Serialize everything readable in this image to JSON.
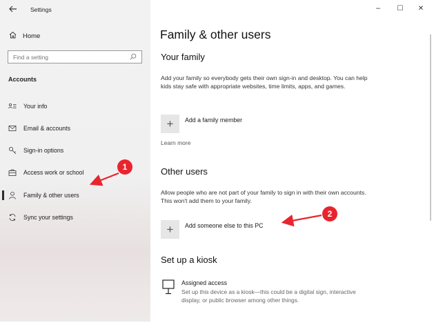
{
  "window": {
    "title": "Settings",
    "controls": {
      "minimize": "–",
      "maximize": "☐",
      "close": "✕"
    }
  },
  "sidebar": {
    "home_label": "Home",
    "search_placeholder": "Find a setting",
    "section_label": "Accounts",
    "items": [
      {
        "label": "Your info",
        "icon": "your-info-icon"
      },
      {
        "label": "Email & accounts",
        "icon": "mail-icon"
      },
      {
        "label": "Sign-in options",
        "icon": "key-icon"
      },
      {
        "label": "Access work or school",
        "icon": "briefcase-icon"
      },
      {
        "label": "Family & other users",
        "icon": "person-icon",
        "selected": true
      },
      {
        "label": "Sync your settings",
        "icon": "sync-icon"
      }
    ]
  },
  "main": {
    "title": "Family & other users",
    "your_family": {
      "heading": "Your family",
      "description": "Add your family so everybody gets their own sign-in and desktop. You can help kids stay safe with appropriate websites, time limits, apps, and games.",
      "add_label": "Add a family member",
      "learn_more": "Learn more"
    },
    "other_users": {
      "heading": "Other users",
      "description": "Allow people who are not part of your family to sign in with their own accounts. This won't add them to your family.",
      "add_label": "Add someone else to this PC"
    },
    "kiosk": {
      "heading": "Set up a kiosk",
      "item_title": "Assigned access",
      "item_description": "Set up this device as a kiosk—this could be a digital sign, interactive display, or public browser among other things."
    }
  },
  "annotations": {
    "badge1": "1",
    "badge2": "2",
    "color": "#e8252f"
  }
}
